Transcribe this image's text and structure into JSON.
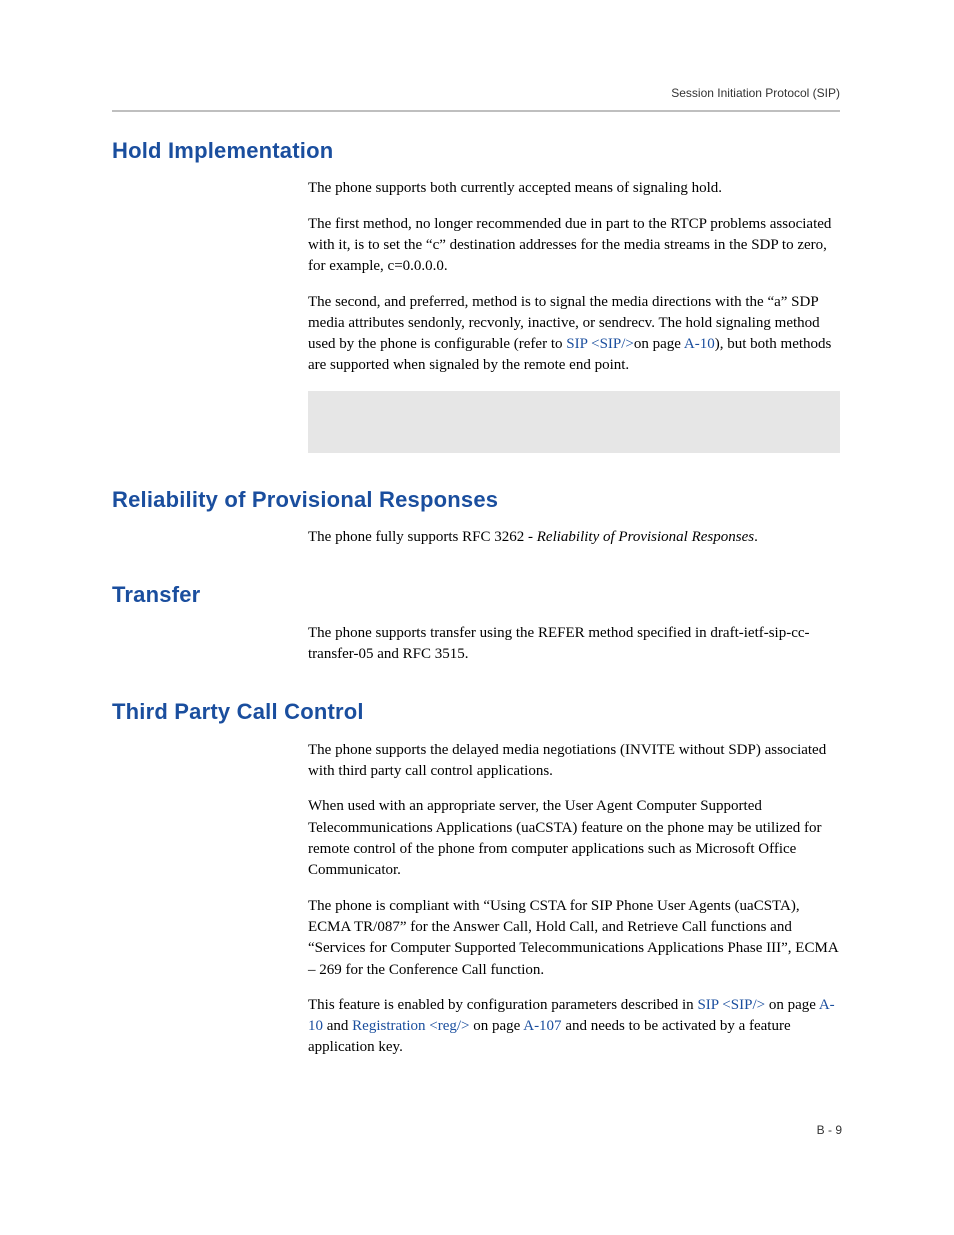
{
  "header": {
    "running_head": "Session Initiation Protocol (SIP)"
  },
  "sections": {
    "hold": {
      "title": "Hold Implementation",
      "p1": "The phone supports both currently accepted means of signaling hold.",
      "p2": "The first method, no longer recommended due in part to the RTCP problems associated with it, is to set the “c” destination addresses for the media streams in the SDP to zero, for example, c=0.0.0.0.",
      "p3a": "The second, and preferred, method is to signal the media directions with the “a” SDP media attributes sendonly, recvonly, inactive, or sendrecv. The hold signaling method used by the phone is configurable (refer to ",
      "p3_link1": "SIP <SIP/>",
      "p3b": "on page ",
      "p3_link2": "A-10",
      "p3c": "), but both methods are supported when signaled by the remote end point."
    },
    "reliability": {
      "title": "Reliability of Provisional Responses",
      "p1a": "The phone fully supports RFC 3262 - ",
      "p1_italic": "Reliability of Provisional Responses",
      "p1b": "."
    },
    "transfer": {
      "title": "Transfer",
      "p1": "The phone supports transfer using the REFER method specified in draft-ietf-sip-cc-transfer-05 and RFC 3515."
    },
    "tpcc": {
      "title": "Third Party Call Control",
      "p1": "The phone supports the delayed media negotiations (INVITE without SDP) associated with third party call control applications.",
      "p2": "When used with an appropriate server, the User Agent Computer Supported Telecommunications Applications (uaCSTA) feature on the phone may be utilized for remote control of the phone from computer applications such as Microsoft Office Communicator.",
      "p3": "The phone is compliant with “Using CSTA for SIP Phone User Agents (uaCSTA), ECMA TR/087” for the Answer Call, Hold Call, and Retrieve Call functions and “Services for Computer Supported Telecommunications Applications Phase III”, ECMA – 269 for the Conference Call function.",
      "p4a": "This feature is enabled by configuration parameters described in ",
      "p4_link1": "SIP <SIP/>",
      "p4b": " on page ",
      "p4_link2": "A-10",
      "p4c": " and ",
      "p4_link3": "Registration <reg/>",
      "p4d": " on page ",
      "p4_link4": "A-107",
      "p4e": " and needs to be activated by a feature application key."
    }
  },
  "footer": {
    "page_number": "B - 9"
  }
}
